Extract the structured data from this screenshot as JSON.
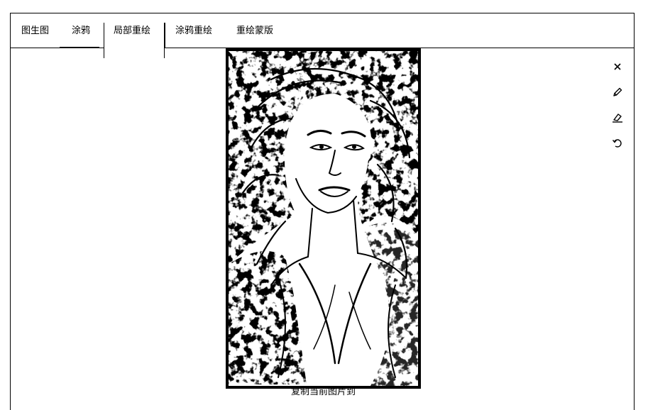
{
  "tabs": [
    {
      "label": "图生图"
    },
    {
      "label": "涂鸦"
    },
    {
      "label": "局部重绘"
    },
    {
      "label": "涂鸦重绘"
    },
    {
      "label": "重绘蒙版"
    }
  ],
  "active_tab": "局部重绘",
  "tools": [
    {
      "icon": "close-icon",
      "glyph": "✕"
    },
    {
      "icon": "pencil-icon",
      "glyph": "✎"
    },
    {
      "icon": "eraser-icon",
      "glyph": "⌫"
    },
    {
      "icon": "undo-icon",
      "glyph": "↶"
    }
  ],
  "canvas": {
    "caption": "复制当前图片到"
  },
  "colors": {
    "border": "#000000",
    "background": "#ffffff"
  }
}
